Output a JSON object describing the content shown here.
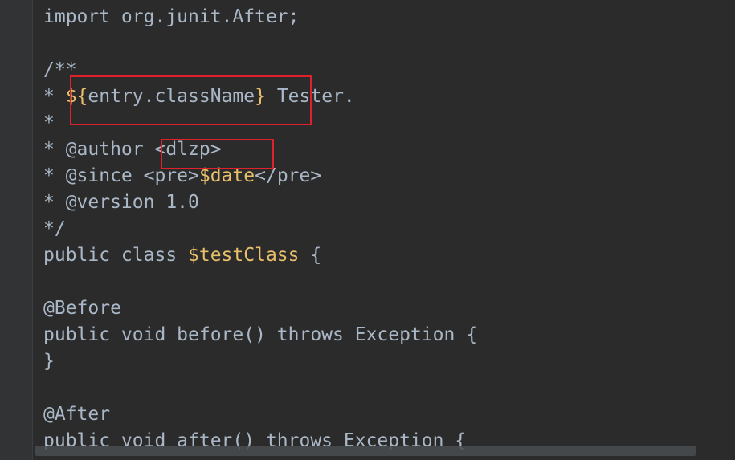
{
  "editor": {
    "lines": [
      {
        "tokens": [
          {
            "t": "import org.junit.After;",
            "k": "plain"
          }
        ]
      },
      {
        "tokens": []
      },
      {
        "tokens": [
          {
            "t": "/**",
            "k": "plain"
          }
        ]
      },
      {
        "tokens": [
          {
            "t": "* ",
            "k": "plain"
          },
          {
            "t": "${",
            "k": "var"
          },
          {
            "t": "entry.className",
            "k": "plain"
          },
          {
            "t": "}",
            "k": "var"
          },
          {
            "t": " Tester.",
            "k": "plain"
          }
        ]
      },
      {
        "tokens": [
          {
            "t": "*",
            "k": "plain"
          }
        ]
      },
      {
        "tokens": [
          {
            "t": "* @author ",
            "k": "plain"
          },
          {
            "t": "<dlzp>",
            "k": "plain"
          }
        ]
      },
      {
        "tokens": [
          {
            "t": "* @since <pre>",
            "k": "plain"
          },
          {
            "t": "$date",
            "k": "var"
          },
          {
            "t": "</pre>",
            "k": "plain"
          }
        ]
      },
      {
        "tokens": [
          {
            "t": "* @version 1.0",
            "k": "plain"
          }
        ]
      },
      {
        "tokens": [
          {
            "t": "*/",
            "k": "plain"
          }
        ]
      },
      {
        "tokens": [
          {
            "t": "public class ",
            "k": "plain"
          },
          {
            "t": "$testClass",
            "k": "var"
          },
          {
            "t": " {",
            "k": "plain"
          }
        ]
      },
      {
        "tokens": []
      },
      {
        "tokens": [
          {
            "t": "@Before",
            "k": "plain"
          }
        ]
      },
      {
        "tokens": [
          {
            "t": "public void before() throws Exception {",
            "k": "plain"
          }
        ]
      },
      {
        "tokens": [
          {
            "t": "}",
            "k": "plain"
          }
        ]
      },
      {
        "tokens": []
      },
      {
        "tokens": [
          {
            "t": "@After",
            "k": "plain"
          }
        ]
      },
      {
        "tokens": [
          {
            "t": "public void after() throws Exception {",
            "k": "plain"
          }
        ]
      }
    ]
  },
  "colors": {
    "background": "#2b2b2b",
    "text": "#a9b7c6",
    "template_variable": "#e8bf6a",
    "annotation_box": "#e0202a"
  }
}
